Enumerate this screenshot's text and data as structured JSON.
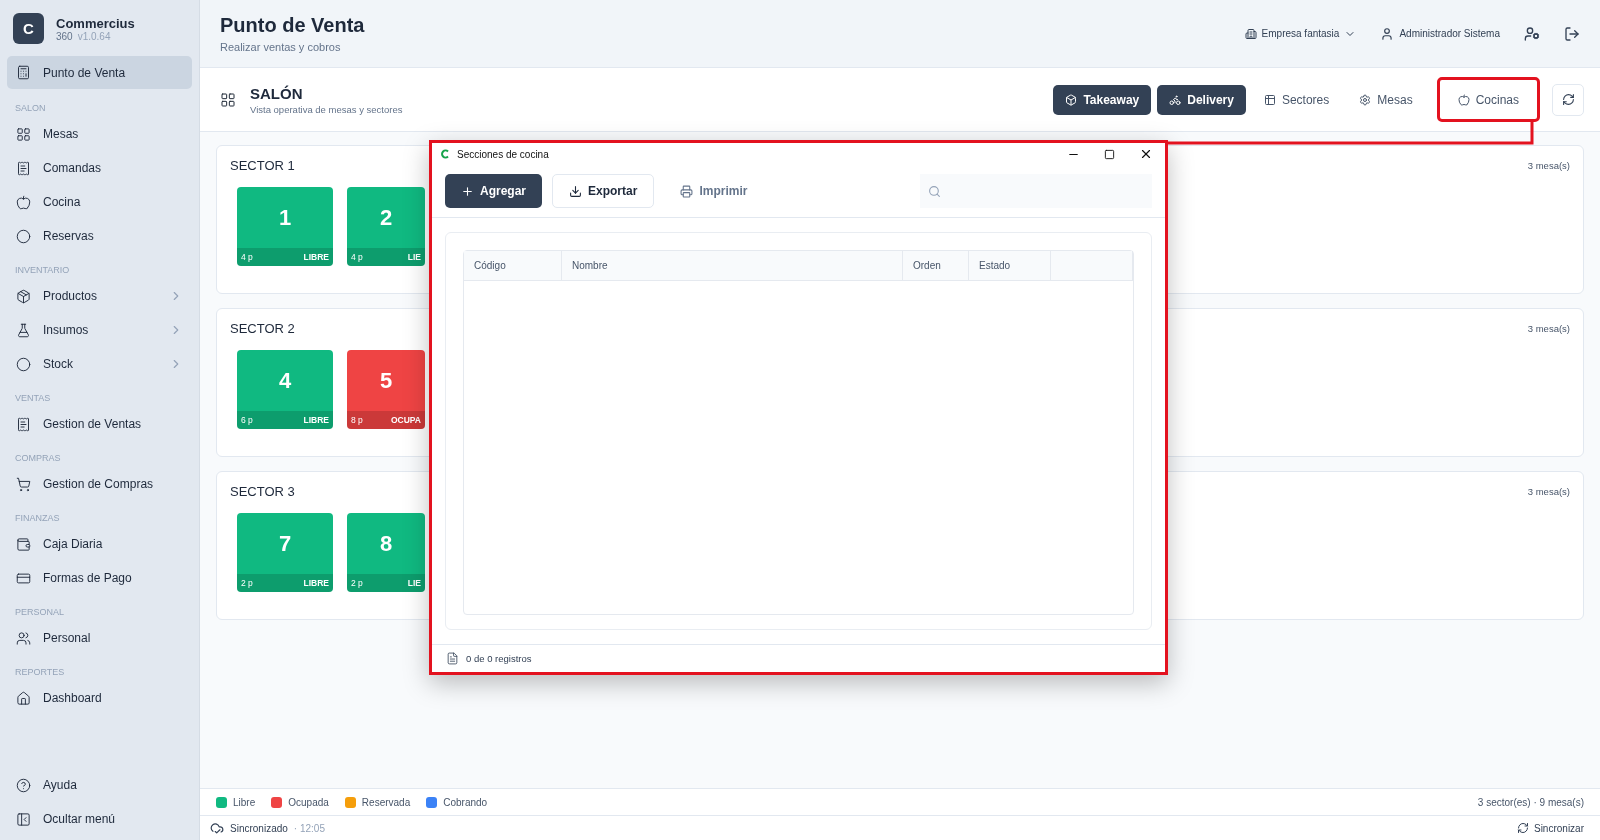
{
  "brand": {
    "initial": "C",
    "name": "Commercius",
    "edition": "360",
    "version": "v1.0.64"
  },
  "sidebar": {
    "groups": [
      {
        "items": [
          {
            "label": "Punto de Venta",
            "selected": true,
            "submenu": false
          }
        ]
      },
      {
        "label": "SALON",
        "items": [
          {
            "label": "Mesas",
            "selected": false,
            "submenu": false
          },
          {
            "label": "Comandas",
            "selected": false,
            "submenu": false
          },
          {
            "label": "Cocina",
            "selected": false,
            "submenu": false
          },
          {
            "label": "Reservas",
            "selected": false,
            "submenu": false
          }
        ]
      },
      {
        "label": "INVENTARIO",
        "items": [
          {
            "label": "Productos",
            "selected": false,
            "submenu": true
          },
          {
            "label": "Insumos",
            "selected": false,
            "submenu": true
          },
          {
            "label": "Stock",
            "selected": false,
            "submenu": true
          }
        ]
      },
      {
        "label": "VENTAS",
        "items": [
          {
            "label": "Gestion de Ventas",
            "selected": false,
            "submenu": false
          }
        ]
      },
      {
        "label": "COMPRAS",
        "items": [
          {
            "label": "Gestion de Compras",
            "selected": false,
            "submenu": false
          }
        ]
      },
      {
        "label": "FINANZAS",
        "items": [
          {
            "label": "Caja Diaria",
            "selected": false,
            "submenu": false
          },
          {
            "label": "Formas de Pago",
            "selected": false,
            "submenu": false
          }
        ]
      },
      {
        "label": "PERSONAL",
        "items": [
          {
            "label": "Personal",
            "selected": false,
            "submenu": false
          }
        ]
      },
      {
        "label": "REPORTES",
        "items": [
          {
            "label": "Dashboard",
            "selected": false,
            "submenu": false
          }
        ]
      }
    ],
    "footer": [
      "Ayuda",
      "Ocultar menú"
    ]
  },
  "header": {
    "title": "Punto de Venta",
    "subtitle": "Realizar ventas y cobros",
    "company": "Empresa fantasia",
    "user": "Administrador Sistema"
  },
  "section": {
    "title": "SALÓN",
    "subtitle": "Vista operativa de mesas y sectores",
    "actions": [
      {
        "label": "Takeaway",
        "kind": "primary",
        "highlighted": false
      },
      {
        "label": "Delivery",
        "kind": "primary",
        "highlighted": false
      },
      {
        "label": "Sectores",
        "kind": "ghost",
        "highlighted": false
      },
      {
        "label": "Mesas",
        "kind": "ghost",
        "highlighted": false
      },
      {
        "label": "Cocinas",
        "kind": "ghost",
        "highlighted": true
      }
    ]
  },
  "sectors": [
    {
      "name": "SECTOR 1",
      "count": "3  mesa(s)",
      "tables": [
        {
          "number": "1",
          "seats": "4 p",
          "status": "LIBRE",
          "color": "#10b981"
        },
        {
          "number": "2",
          "seats": "4 p",
          "status": "LIE",
          "color": "#10b981"
        }
      ]
    },
    {
      "name": "SECTOR 2",
      "count": "3  mesa(s)",
      "tables": [
        {
          "number": "4",
          "seats": "6 p",
          "status": "LIBRE",
          "color": "#10b981"
        },
        {
          "number": "5",
          "seats": "8 p",
          "status": "OCUPA",
          "color": "#ef4444"
        }
      ]
    },
    {
      "name": "SECTOR 3",
      "count": "3  mesa(s)",
      "tables": [
        {
          "number": "7",
          "seats": "2 p",
          "status": "LIBRE",
          "color": "#10b981"
        },
        {
          "number": "8",
          "seats": "2 p",
          "status": "LIE",
          "color": "#10b981"
        }
      ]
    }
  ],
  "legend": {
    "items": [
      {
        "label": "Libre",
        "color": "#10b981"
      },
      {
        "label": "Ocupada",
        "color": "#ef4444"
      },
      {
        "label": "Reservada",
        "color": "#f59e0b"
      },
      {
        "label": "Cobrando",
        "color": "#3b82f6"
      }
    ],
    "summary": "3 sector(es) · 9 mesa(s)"
  },
  "status_bar": {
    "state": "Sincronizado",
    "time": "· 12:05",
    "action": "Sincronizar"
  },
  "dialog": {
    "title": "Secciones de cocina",
    "highlighted": true,
    "buttons": [
      {
        "label": "Agregar",
        "kind": "primary"
      },
      {
        "label": "Exportar",
        "kind": "outline"
      },
      {
        "label": "Imprimir",
        "kind": "ghost"
      }
    ],
    "table": {
      "columns": [
        "Código",
        "Nombre",
        "Orden",
        "Estado"
      ]
    },
    "footer": "0 de 0 registros"
  }
}
